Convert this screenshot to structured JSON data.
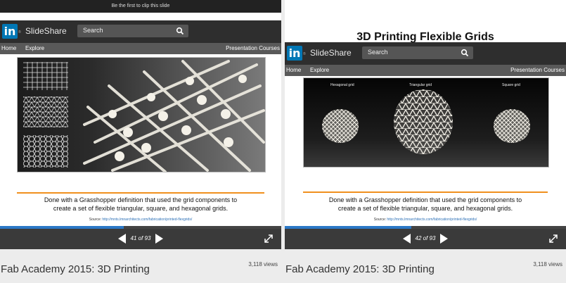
{
  "left": {
    "clip_banner": "Be the first to clip this slide",
    "header": {
      "brand": "SlideShare",
      "search_placeholder": "Search"
    },
    "nav": {
      "home": "Home",
      "explore": "Explore",
      "courses": "Presentation Courses"
    },
    "slide": {
      "caption_line1": "Done with a  Grasshopper definition that used the grid components to",
      "caption_line2": "create a set of flexible triangular, square, and hexagonal grids.",
      "source_label": "Source:",
      "source_url": "http://mnts.lmnarchitects.com/fabrication/printed-flexgrids/"
    },
    "player": {
      "counter": "41 of 93",
      "progress": 0.44
    },
    "deck_title": "Fab Academy 2015: 3D Printing",
    "views": "3,118 views"
  },
  "right": {
    "slide_title": "3D Printing Flexible Grids",
    "header": {
      "brand": "SlideShare",
      "search_placeholder": "Search"
    },
    "nav": {
      "home": "Home",
      "explore": "Explore",
      "courses": "Presentation Courses"
    },
    "slide": {
      "label_hex": "Hexagonal grid",
      "label_tri": "Triangular grid",
      "label_sq": "Square grid",
      "caption_line1": "Done with a  Grasshopper definition that used the grid components to",
      "caption_line2": "create a set of flexible triangular, square, and hexagonal grids.",
      "source_label": "Source:",
      "source_url": "http://mnts.lmnarchitects.com/fabrication/printed-flexgrids/"
    },
    "player": {
      "counter": "42 of 93",
      "progress": 0.45
    },
    "deck_title": "Fab Academy 2015: 3D Printing",
    "views": "3,118 views"
  },
  "colors": {
    "linkedin_blue": "#0077b5",
    "progress_blue": "#2b78c6",
    "accent_orange": "#f0901e"
  }
}
